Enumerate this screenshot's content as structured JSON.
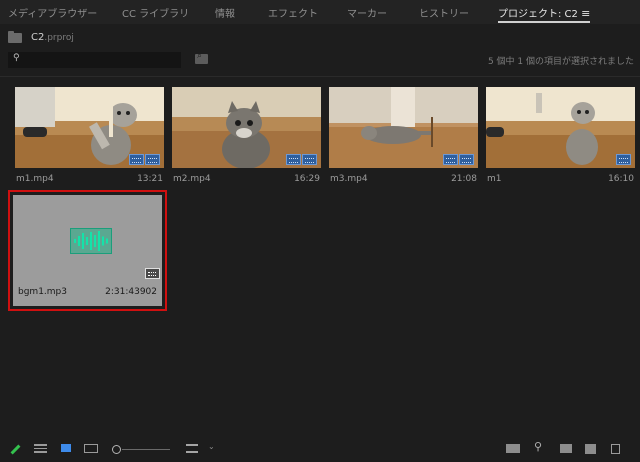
{
  "tabs": [
    {
      "label": "メディアブラウザー"
    },
    {
      "label": "CC ライブラリ"
    },
    {
      "label": "情報"
    },
    {
      "label": "エフェクト"
    },
    {
      "label": "マーカー"
    },
    {
      "label": "ヒストリー"
    },
    {
      "label": "プロジェクト: C2"
    }
  ],
  "project": {
    "name": "C2",
    "ext": ".prproj"
  },
  "search": {
    "value": "",
    "placeholder": ""
  },
  "status": "5 個中 1 個の項目が選択されました",
  "items": [
    {
      "name": "m1.mp4",
      "duration": "13:21"
    },
    {
      "name": "m2.mp4",
      "duration": "16:29"
    },
    {
      "name": "m3.mp4",
      "duration": "21:08"
    },
    {
      "name": "m1",
      "duration": "16:10"
    }
  ],
  "selected_item": {
    "name": "bgm1.mp3",
    "duration": "2:31:43902"
  },
  "colors": {
    "selection_border": "#d01010",
    "waveform": "#14e3a9",
    "accent_blue": "#3e8bea"
  },
  "icons": {
    "menu": "hamburger-icon",
    "search": "search-icon",
    "bottom": [
      "pencil-icon",
      "list-view-icon",
      "icon-view-icon",
      "freeform-view-icon",
      "zoom-slider",
      "sort-icon",
      "automate-sequence-icon",
      "find-icon",
      "new-bin-icon",
      "new-item-icon",
      "trash-icon"
    ]
  }
}
